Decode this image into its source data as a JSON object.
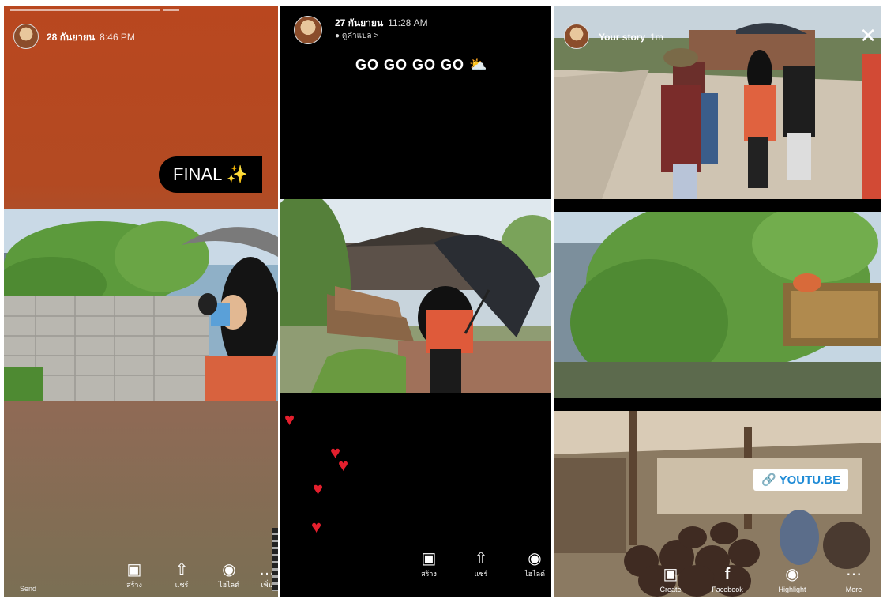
{
  "panel1": {
    "header_name": "28 กันยายน",
    "header_time": "8:46 PM",
    "sticker_text": "FINAL ✨",
    "bottom_left": "Send",
    "actions": [
      {
        "icon": "▣",
        "label": "สร้าง"
      },
      {
        "icon": "⇧",
        "label": "แชร์"
      },
      {
        "icon": "◉",
        "label": "ไฮไลต์"
      },
      {
        "icon": "…",
        "label": "เพิ่ม"
      }
    ]
  },
  "panel2": {
    "header_name": "27 กันยายน",
    "header_time": "11:28 AM",
    "header_sub": "● ดูคำแปล >",
    "caption": "GO  GO  GO  GO  ⛅",
    "actions": [
      {
        "icon": "▣",
        "label": "สร้าง"
      },
      {
        "icon": "⇧",
        "label": "แชร์"
      },
      {
        "icon": "◉",
        "label": "ไฮไลต์"
      }
    ]
  },
  "panel3": {
    "header_name": "Your story",
    "header_time": "1m",
    "close": "✕",
    "link_text": "🔗 YOUTU.BE",
    "actions": [
      {
        "icon": "▣",
        "label": "Create"
      },
      {
        "icon": "f",
        "label": "Facebook"
      },
      {
        "icon": "◉",
        "label": "Highlight"
      },
      {
        "icon": "⋯",
        "label": "More"
      }
    ]
  }
}
